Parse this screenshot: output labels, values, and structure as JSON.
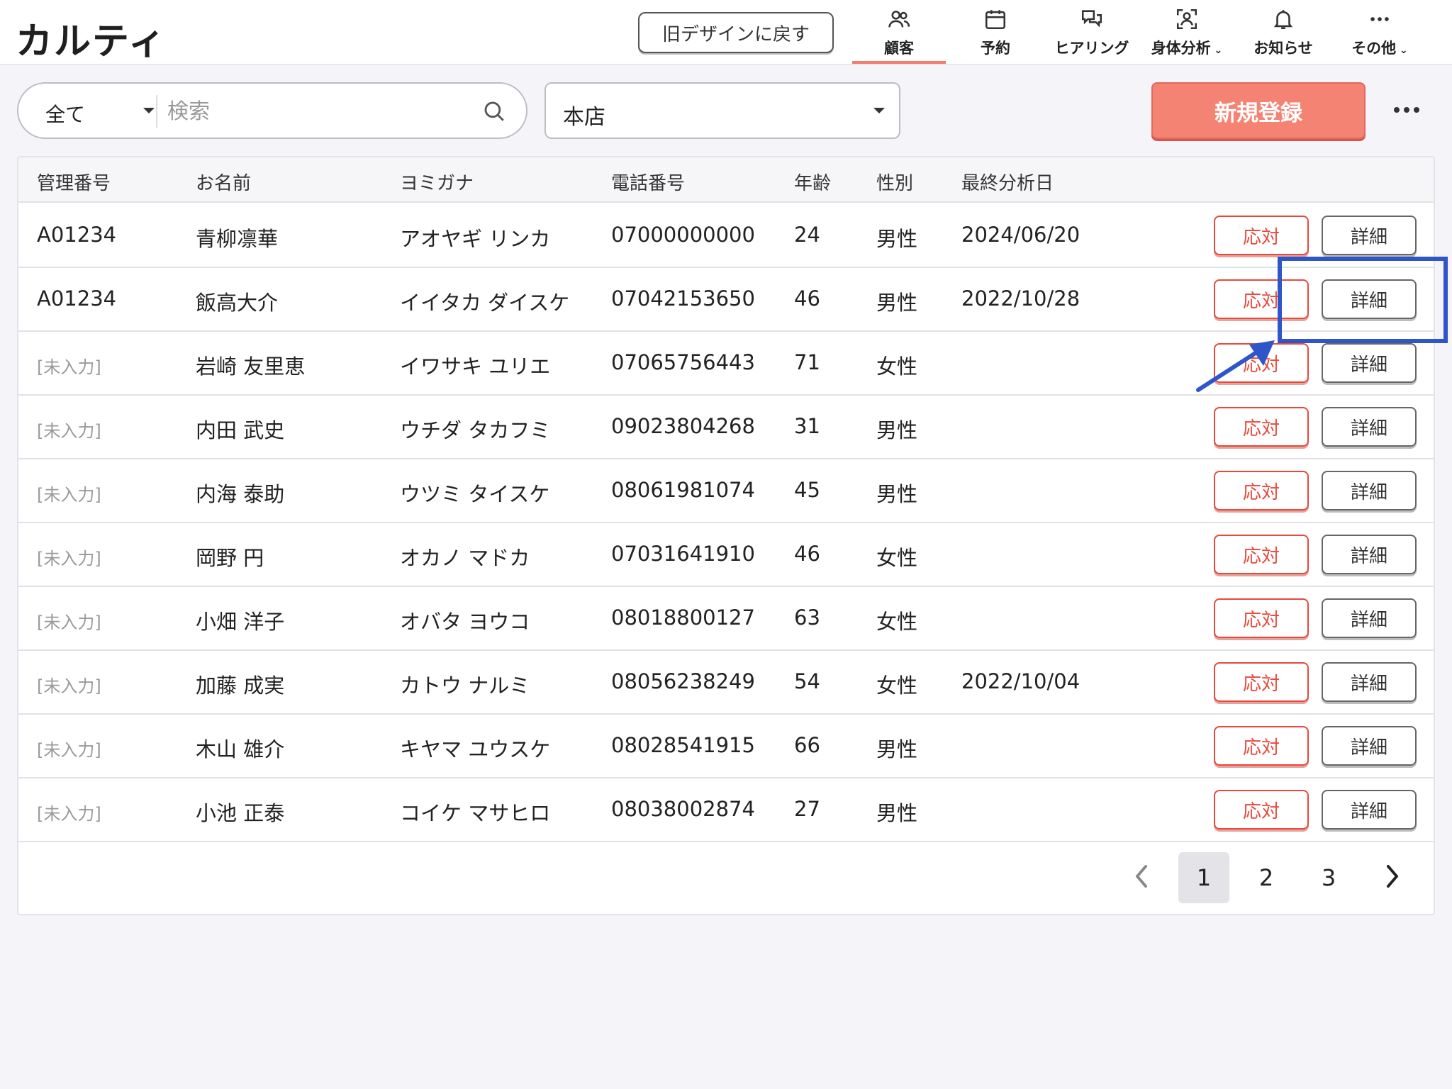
{
  "app": {
    "logo": "カルティ"
  },
  "header": {
    "old_design_label": "旧デザインに戻す",
    "nav": [
      {
        "label": "顧客",
        "icon": "users-icon",
        "active": true
      },
      {
        "label": "予約",
        "icon": "calendar-icon",
        "active": false
      },
      {
        "label": "ヒアリング",
        "icon": "chat-icon",
        "active": false
      },
      {
        "label": "身体分析",
        "icon": "body-scan-icon",
        "active": false,
        "dropdown": true
      },
      {
        "label": "お知らせ",
        "icon": "bell-icon",
        "active": false
      },
      {
        "label": "その他",
        "icon": "more-icon",
        "active": false,
        "dropdown": true
      }
    ]
  },
  "toolbar": {
    "filter_value": "全て",
    "search_placeholder": "検索",
    "store_value": "本店",
    "register_label": "新規登録"
  },
  "table": {
    "headers": [
      "管理番号",
      "お名前",
      "ヨミガナ",
      "電話番号",
      "年齢",
      "性別",
      "最終分析日"
    ],
    "respond_label": "応対",
    "detail_label": "詳細",
    "rows": [
      {
        "id": "A01234",
        "id_missing": false,
        "name": "青柳凛華",
        "kana": "アオヤギ リンカ",
        "phone": "07000000000",
        "age": "24",
        "gender": "男性",
        "last_analysis": "2024/06/20"
      },
      {
        "id": "A01234",
        "id_missing": false,
        "name": "飯高大介",
        "kana": "イイタカ ダイスケ",
        "phone": "07042153650",
        "age": "46",
        "gender": "男性",
        "last_analysis": "2022/10/28"
      },
      {
        "id": "[未入力]",
        "id_missing": true,
        "name": "岩崎 友里恵",
        "kana": "イワサキ ユリエ",
        "phone": "07065756443",
        "age": "71",
        "gender": "女性",
        "last_analysis": ""
      },
      {
        "id": "[未入力]",
        "id_missing": true,
        "name": "内田 武史",
        "kana": "ウチダ タカフミ",
        "phone": "09023804268",
        "age": "31",
        "gender": "男性",
        "last_analysis": ""
      },
      {
        "id": "[未入力]",
        "id_missing": true,
        "name": "内海 泰助",
        "kana": "ウツミ タイスケ",
        "phone": "08061981074",
        "age": "45",
        "gender": "男性",
        "last_analysis": ""
      },
      {
        "id": "[未入力]",
        "id_missing": true,
        "name": "岡野 円",
        "kana": "オカノ マドカ",
        "phone": "07031641910",
        "age": "46",
        "gender": "女性",
        "last_analysis": ""
      },
      {
        "id": "[未入力]",
        "id_missing": true,
        "name": "小畑 洋子",
        "kana": "オバタ ヨウコ",
        "phone": "08018800127",
        "age": "63",
        "gender": "女性",
        "last_analysis": ""
      },
      {
        "id": "[未入力]",
        "id_missing": true,
        "name": "加藤 成実",
        "kana": "カトウ ナルミ",
        "phone": "08056238249",
        "age": "54",
        "gender": "女性",
        "last_analysis": "2022/10/04"
      },
      {
        "id": "[未入力]",
        "id_missing": true,
        "name": "木山 雄介",
        "kana": "キヤマ ユウスケ",
        "phone": "08028541915",
        "age": "66",
        "gender": "男性",
        "last_analysis": ""
      },
      {
        "id": "[未入力]",
        "id_missing": true,
        "name": "小池 正泰",
        "kana": "コイケ マサヒロ",
        "phone": "08038002874",
        "age": "27",
        "gender": "男性",
        "last_analysis": ""
      }
    ]
  },
  "pagination": {
    "pages": [
      "1",
      "2",
      "3"
    ],
    "current": "1"
  },
  "colors": {
    "accent": "#f58373",
    "danger": "#e8493b",
    "annotation": "#2f56c8"
  }
}
